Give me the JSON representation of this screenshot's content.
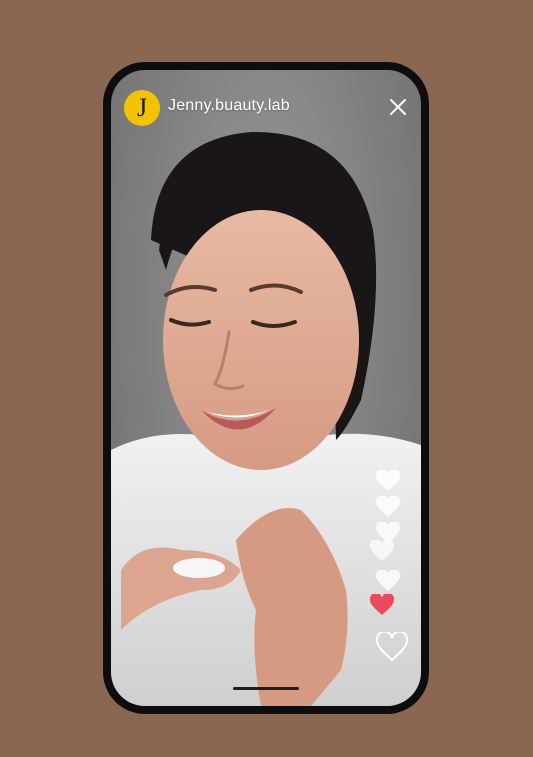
{
  "stream": {
    "avatar_letter": "J",
    "username": "Jenny.buauty.lab"
  },
  "icons": {
    "avatar": "letter-avatar",
    "close": "close-icon",
    "like": "heart-outline-icon",
    "reaction": "heart-icon"
  },
  "colors": {
    "background": "#8a6753",
    "avatar": "#f3c300",
    "liked_heart": "#e94b58"
  }
}
